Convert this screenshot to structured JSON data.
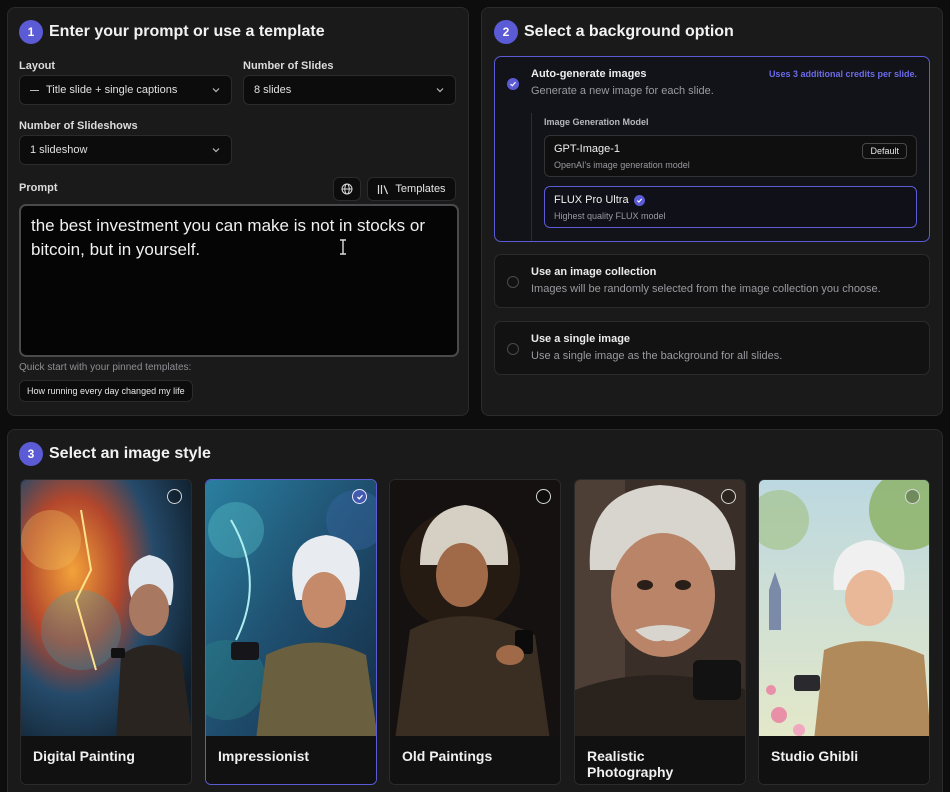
{
  "section1": {
    "step": "1",
    "title": "Enter your prompt or use a template",
    "layout_label": "Layout",
    "layout_value": "Title slide + single captions",
    "slides_label": "Number of Slides",
    "slides_value": "8 slides",
    "slideshows_label": "Number of Slideshows",
    "slideshows_value": "1 slideshow",
    "prompt_label": "Prompt",
    "templates_button": "Templates",
    "prompt_text": "the best investment you can make is not in stocks or bitcoin, but in yourself.",
    "quick_start_hint": "Quick start with your pinned templates:",
    "pinned_template": "How running every day changed my life"
  },
  "section2": {
    "step": "2",
    "title": "Select a background option",
    "options": [
      {
        "title": "Auto-generate images",
        "desc": "Generate a new image for each slide.",
        "note": "Uses 3 additional credits per slide.",
        "selected": true
      },
      {
        "title": "Use an image collection",
        "desc": "Images will be randomly selected from the image collection you choose.",
        "selected": false
      },
      {
        "title": "Use a single image",
        "desc": "Use a single image as the background for all slides.",
        "selected": false
      }
    ],
    "model_label": "Image Generation Model",
    "models": [
      {
        "name": "GPT-Image-1",
        "desc": "OpenAI's image generation model",
        "badge": "Default",
        "selected": false
      },
      {
        "name": "FLUX Pro Ultra",
        "desc": "Highest quality FLUX model",
        "selected": true
      }
    ]
  },
  "section3": {
    "step": "3",
    "title": "Select an image style",
    "styles": [
      {
        "label": "Digital Painting",
        "selected": false
      },
      {
        "label": "Impressionist",
        "selected": true
      },
      {
        "label": "Old Paintings",
        "selected": false
      },
      {
        "label": "Realistic Photography",
        "selected": false
      },
      {
        "label": "Studio Ghibli",
        "selected": false
      }
    ]
  },
  "colors": {
    "accent": "#5b5bd6",
    "panel_bg": "#1a1a1b",
    "page_bg": "#0d0d0e"
  }
}
